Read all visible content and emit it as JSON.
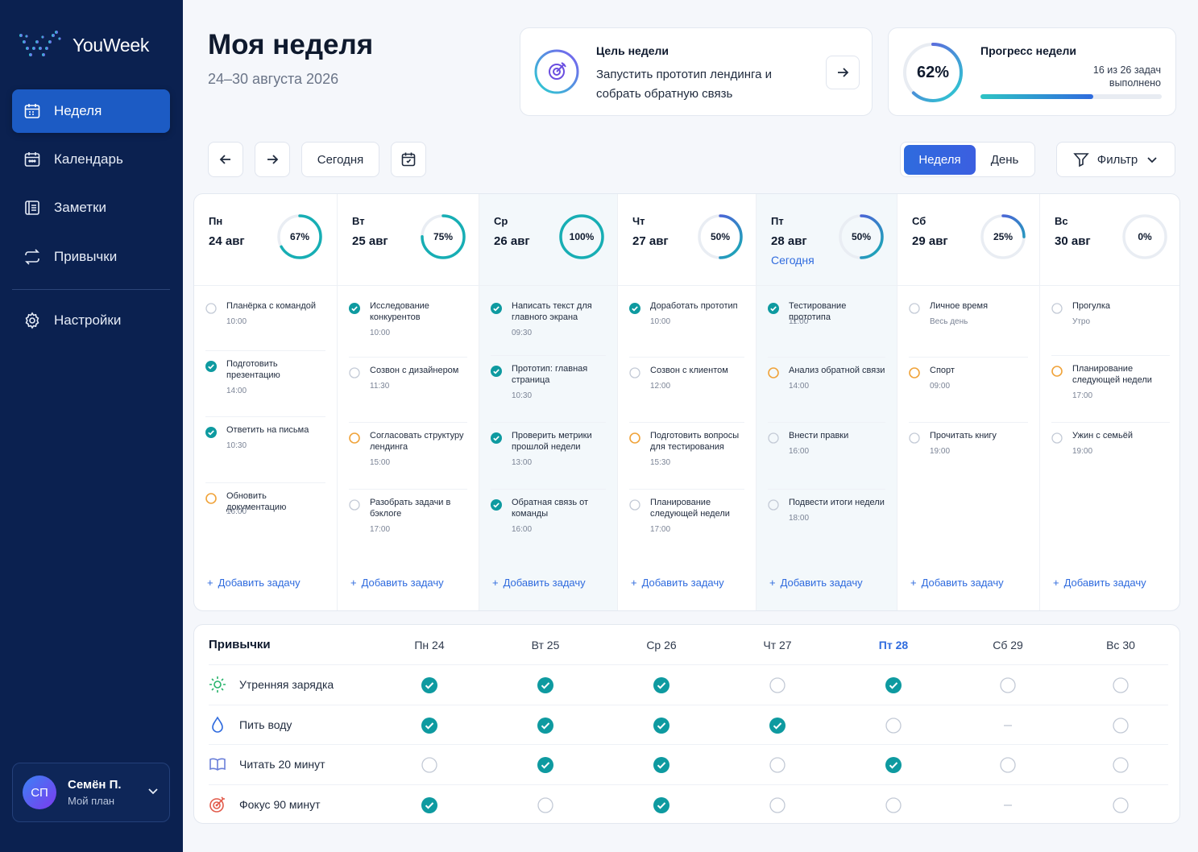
{
  "app": {
    "name": "YouWeek",
    "accent": "#2f6bde",
    "sidebar_bg": "#0b2150",
    "check_color": "#0e9aa0",
    "progress_color": "#f0a33a"
  },
  "nav": [
    {
      "label": "Неделя",
      "icon": "calendar-week-icon",
      "active": true
    },
    {
      "label": "Календарь",
      "icon": "calendar-icon",
      "active": false
    },
    {
      "label": "Заметки",
      "icon": "notes-icon",
      "active": false
    },
    {
      "label": "Привычки",
      "icon": "repeat-icon",
      "active": false
    },
    {
      "label": "Настройки",
      "icon": "gear-icon",
      "active": false
    }
  ],
  "user": {
    "initials": "СП",
    "name": "Семён П.",
    "plan": "Мой план"
  },
  "header": {
    "title": "Моя неделя",
    "subtitle": "24–30 августа 2026"
  },
  "goal": {
    "label": "Цель недели",
    "text": "Запустить прототип лендинга и собрать обратную связь"
  },
  "progress": {
    "label": "Прогресс недели",
    "percent": 62,
    "percent_label": "62%",
    "count_text": "16 из 26 задач выполнено"
  },
  "toolbar": {
    "today": "Сегодня",
    "week": "Неделя",
    "day": "День",
    "filter": "Фильтр"
  },
  "days": [
    {
      "name": "Пн",
      "date": "24 авг",
      "percent": 67,
      "percent_label": "67%",
      "today": false,
      "tasks": [
        {
          "title": "Планёрка с командой",
          "time": "10:00",
          "status": "todo"
        },
        {
          "title": "Подготовить презентацию",
          "time": "14:00",
          "status": "done"
        },
        {
          "title": "Ответить на письма",
          "time": "10:30",
          "status": "done"
        },
        {
          "title": "Обновить документацию",
          "time": "16:00",
          "status": "progress"
        }
      ]
    },
    {
      "name": "Вт",
      "date": "25 авг",
      "percent": 75,
      "percent_label": "75%",
      "today": false,
      "tasks": [
        {
          "title": "Исследование конкурентов",
          "time": "10:00",
          "status": "done"
        },
        {
          "title": "Созвон с дизайнером",
          "time": "11:30",
          "status": "todo"
        },
        {
          "title": "Согласовать структуру лендинга",
          "time": "15:00",
          "status": "progress"
        },
        {
          "title": "Разобрать задачи в бэклоге",
          "time": "17:00",
          "status": "todo"
        }
      ]
    },
    {
      "name": "Ср",
      "date": "26 авг",
      "percent": 100,
      "percent_label": "100%",
      "today": false,
      "tasks": [
        {
          "title": "Написать текст для главного экрана",
          "time": "09:30",
          "status": "done"
        },
        {
          "title": "Прототип: главная страница",
          "time": "10:30",
          "status": "done"
        },
        {
          "title": "Проверить метрики прошлой недели",
          "time": "13:00",
          "status": "done"
        },
        {
          "title": "Обратная связь от команды",
          "time": "16:00",
          "status": "done"
        }
      ]
    },
    {
      "name": "Чт",
      "date": "27 авг",
      "percent": 50,
      "percent_label": "50%",
      "today": false,
      "tasks": [
        {
          "title": "Доработать прототип",
          "time": "10:00",
          "status": "done"
        },
        {
          "title": "Созвон с клиентом",
          "time": "12:00",
          "status": "todo"
        },
        {
          "title": "Подготовить вопросы для тестирования",
          "time": "15:30",
          "status": "progress"
        },
        {
          "title": "Планирование следующей недели",
          "time": "17:00",
          "status": "todo"
        }
      ]
    },
    {
      "name": "Пт",
      "date": "28 авг",
      "percent": 50,
      "percent_label": "50%",
      "today": true,
      "today_label": "Сегодня",
      "tasks": [
        {
          "title": "Тестирование прототипа",
          "time": "11:00",
          "status": "done"
        },
        {
          "title": "Анализ обратной связи",
          "time": "14:00",
          "status": "progress"
        },
        {
          "title": "Внести правки",
          "time": "16:00",
          "status": "todo"
        },
        {
          "title": "Подвести итоги недели",
          "time": "18:00",
          "status": "todo"
        }
      ]
    },
    {
      "name": "Сб",
      "date": "29 авг",
      "percent": 25,
      "percent_label": "25%",
      "today": false,
      "tasks": [
        {
          "title": "Личное время",
          "time": "Весь день",
          "status": "todo"
        },
        {
          "title": "Спорт",
          "time": "09:00",
          "status": "progress"
        },
        {
          "title": "Прочитать книгу",
          "time": "19:00",
          "status": "todo"
        }
      ]
    },
    {
      "name": "Вс",
      "date": "30 авг",
      "percent": 0,
      "percent_label": "0%",
      "today": false,
      "tasks": [
        {
          "title": "Прогулка",
          "time": "Утро",
          "status": "todo"
        },
        {
          "title": "Планирование следующей недели",
          "time": "17:00",
          "status": "progress"
        },
        {
          "title": "Ужин с семьёй",
          "time": "19:00",
          "status": "todo"
        }
      ]
    }
  ],
  "add_task_label": "Добавить задачу",
  "habits": {
    "title": "Привычки",
    "days": [
      "Пн 24",
      "Вт 25",
      "Ср 26",
      "Чт 27",
      "Пт 28",
      "Сб 29",
      "Вс 30"
    ],
    "rows": [
      {
        "name": "Утренняя зарядка",
        "icon": "sun-icon",
        "icon_color": "#27b36b",
        "marks": [
          "done",
          "done",
          "done",
          "empty",
          "done",
          "empty",
          "empty"
        ]
      },
      {
        "name": "Пить воду",
        "icon": "water-drop-icon",
        "icon_color": "#2f6bde",
        "marks": [
          "done",
          "done",
          "done",
          "done",
          "empty",
          "skip",
          "empty"
        ]
      },
      {
        "name": "Читать 20 минут",
        "icon": "book-icon",
        "icon_color": "#6a7fd9",
        "marks": [
          "empty",
          "done",
          "done",
          "empty",
          "done",
          "empty",
          "empty"
        ]
      },
      {
        "name": "Фокус 90 минут",
        "icon": "target-icon",
        "icon_color": "#e25a4a",
        "marks": [
          "done",
          "empty",
          "done",
          "empty",
          "empty",
          "skip",
          "empty"
        ]
      }
    ]
  }
}
